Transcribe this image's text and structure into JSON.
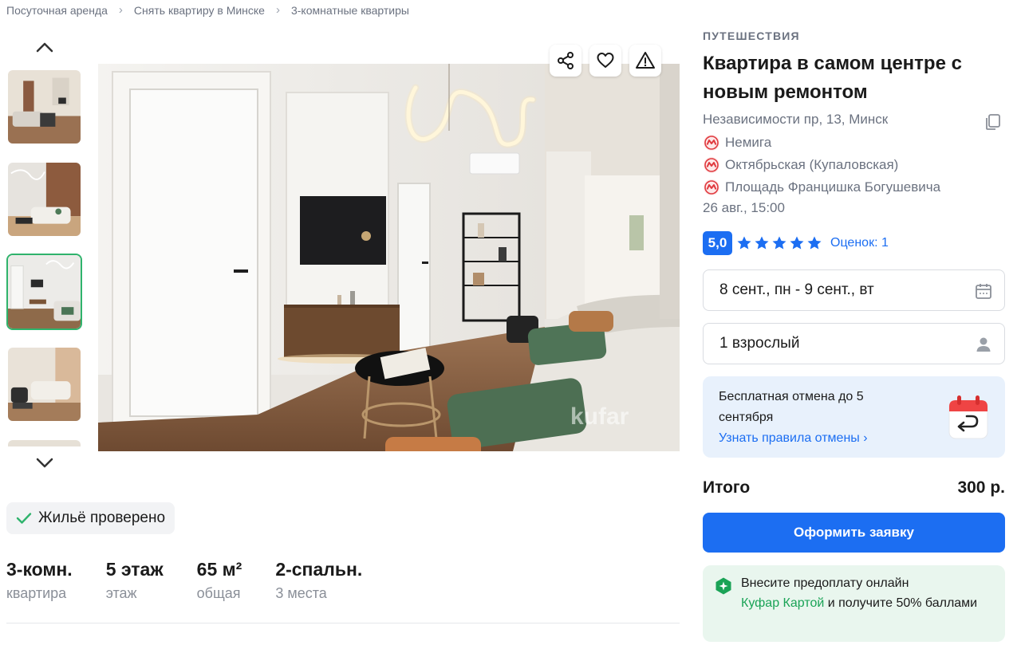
{
  "breadcrumb": [
    {
      "label": "Посуточная аренда"
    },
    {
      "label": "Снять квартиру в Минске"
    },
    {
      "label": "3-комнатные квартиры"
    }
  ],
  "photo": {
    "watermark": "kufar"
  },
  "verified": {
    "label": "Жильё проверено"
  },
  "specs": [
    {
      "value": "3-комн.",
      "label": "квартира"
    },
    {
      "value": "5 этаж",
      "label": "этаж"
    },
    {
      "value": "65 м²",
      "label": "общая"
    },
    {
      "value": "2-спальн.",
      "label": "3 места"
    }
  ],
  "listing": {
    "category": "ПУТЕШЕСТВИЯ",
    "title": "Квартира в самом центре с новым ремонтом",
    "address": "Независимости пр, 13, Минск",
    "metro": [
      {
        "name": "Немига"
      },
      {
        "name": "Октябрьская (Купаловская)"
      },
      {
        "name": "Площадь Францишка Богушевича"
      }
    ],
    "posted": "26 авг., 15:00",
    "rating": "5,0",
    "reviews_link": "Оценок: 1"
  },
  "booking": {
    "dates": "8 сент., пн - 9 сент., вт",
    "guests": "1 взрослый",
    "cancel_text": "Бесплатная отмена до 5 сентября",
    "cancel_link": "Узнать правила отмены ›",
    "total_label": "Итого",
    "total_value": "300 р.",
    "submit_label": "Оформить заявку"
  },
  "promo": {
    "text_before": "Внесите предоплату онлайн",
    "link": "Куфар Картой",
    "text_after": "и получите 50% баллами"
  },
  "colors": {
    "accent": "#1c6ef2",
    "green": "#2fb36c",
    "metro_red": "#e0393e"
  }
}
